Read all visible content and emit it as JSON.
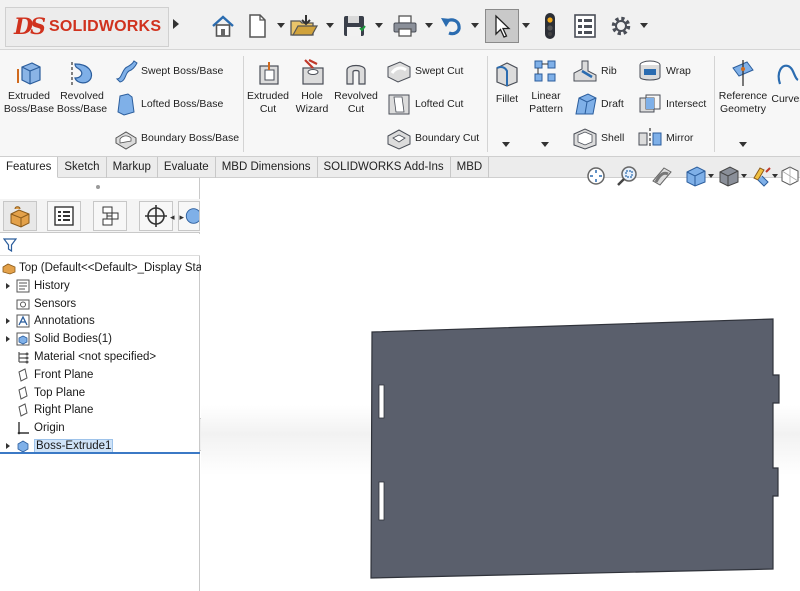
{
  "app": {
    "logo_letters": "DS",
    "logo_name": "SOLIDWORKS"
  },
  "quick_access": {
    "icons": [
      "home-icon",
      "new-document-icon",
      "open-folder-icon",
      "save-icon",
      "print-icon",
      "undo-icon",
      "select-pointer-icon",
      "traffic-light-icon",
      "file-properties-icon",
      "gear-icon"
    ]
  },
  "ribbon": {
    "extruded_boss": "Extruded\nBoss/Base",
    "revolved_boss": "Revolved\nBoss/Base",
    "swept_boss": "Swept Boss/Base",
    "lofted_boss": "Lofted Boss/Base",
    "boundary_boss": "Boundary Boss/Base",
    "extruded_cut": "Extruded\nCut",
    "hole_wizard": "Hole\nWizard",
    "revolved_cut": "Revolved\nCut",
    "swept_cut": "Swept Cut",
    "lofted_cut": "Lofted Cut",
    "boundary_cut": "Boundary Cut",
    "fillet": "Fillet",
    "linear_pattern": "Linear\nPattern",
    "rib": "Rib",
    "draft": "Draft",
    "shell": "Shell",
    "wrap": "Wrap",
    "intersect": "Intersect",
    "mirror": "Mirror",
    "reference_geometry": "Reference\nGeometry",
    "curves": "Curves"
  },
  "tabs": [
    "Features",
    "Sketch",
    "Markup",
    "Evaluate",
    "MBD Dimensions",
    "SOLIDWORKS Add-Ins",
    "MBD"
  ],
  "active_tab": "Features",
  "panel": {
    "manager_tabs": [
      "feature-manager-icon",
      "property-manager-icon",
      "configuration-manager-icon",
      "dimxpert-manager-icon",
      "display-manager-icon"
    ],
    "filter_icon": "filter-icon",
    "root_label": "Top  (Default<<Default>_Display Sta",
    "tree": [
      {
        "label": "History",
        "icon": "history-icon",
        "expandable": true
      },
      {
        "label": "Sensors",
        "icon": "sensors-icon",
        "expandable": false
      },
      {
        "label": "Annotations",
        "icon": "annotations-icon",
        "expandable": true
      },
      {
        "label": "Solid Bodies(1)",
        "icon": "solid-bodies-icon",
        "expandable": true
      },
      {
        "label": "Material <not specified>",
        "icon": "material-icon",
        "expandable": false
      },
      {
        "label": "Front Plane",
        "icon": "plane-icon",
        "expandable": false
      },
      {
        "label": "Top Plane",
        "icon": "plane-icon",
        "expandable": false
      },
      {
        "label": "Right Plane",
        "icon": "plane-icon",
        "expandable": false
      },
      {
        "label": "Origin",
        "icon": "origin-icon",
        "expandable": false
      },
      {
        "label": "Boss-Extrude1",
        "icon": "boss-extrude-icon",
        "expandable": true,
        "selected": true
      }
    ]
  },
  "view_toolbar": {
    "icons": [
      "zoom-to-fit-icon",
      "zoom-to-area-icon",
      "section-view-icon",
      "view-orientation-icon",
      "display-style-icon",
      "appearance-icon",
      "scenes-icon"
    ]
  },
  "model": {
    "fill_color": "#5a5f6c",
    "edge_color": "#2f323a",
    "slot_color": "#ffffff"
  }
}
